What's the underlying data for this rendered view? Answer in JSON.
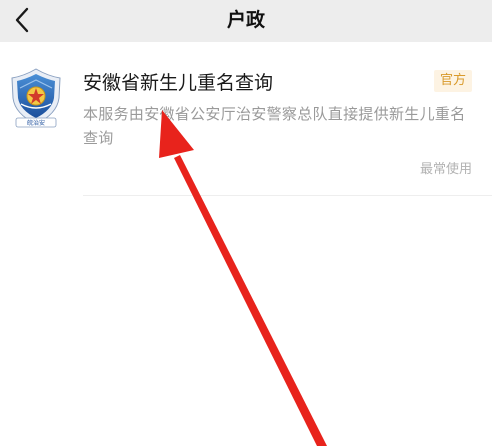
{
  "header": {
    "title": "户政",
    "back_icon": "chevron-left-icon"
  },
  "result": {
    "logo_icon": "police-shield-badge-icon",
    "logo_caption": "皖治安",
    "title": "安徽省新生儿重名查询",
    "badge": "官方",
    "description": "本服务由安徽省公安厅治安警察总队直接提供新生儿重名查询",
    "usage": "最常使用"
  },
  "colors": {
    "header_bg": "#ededed",
    "badge_text": "#d99a2b",
    "badge_bg": "#fdf3e3",
    "arrow": "#e8231c",
    "description": "#9a9a9a"
  }
}
